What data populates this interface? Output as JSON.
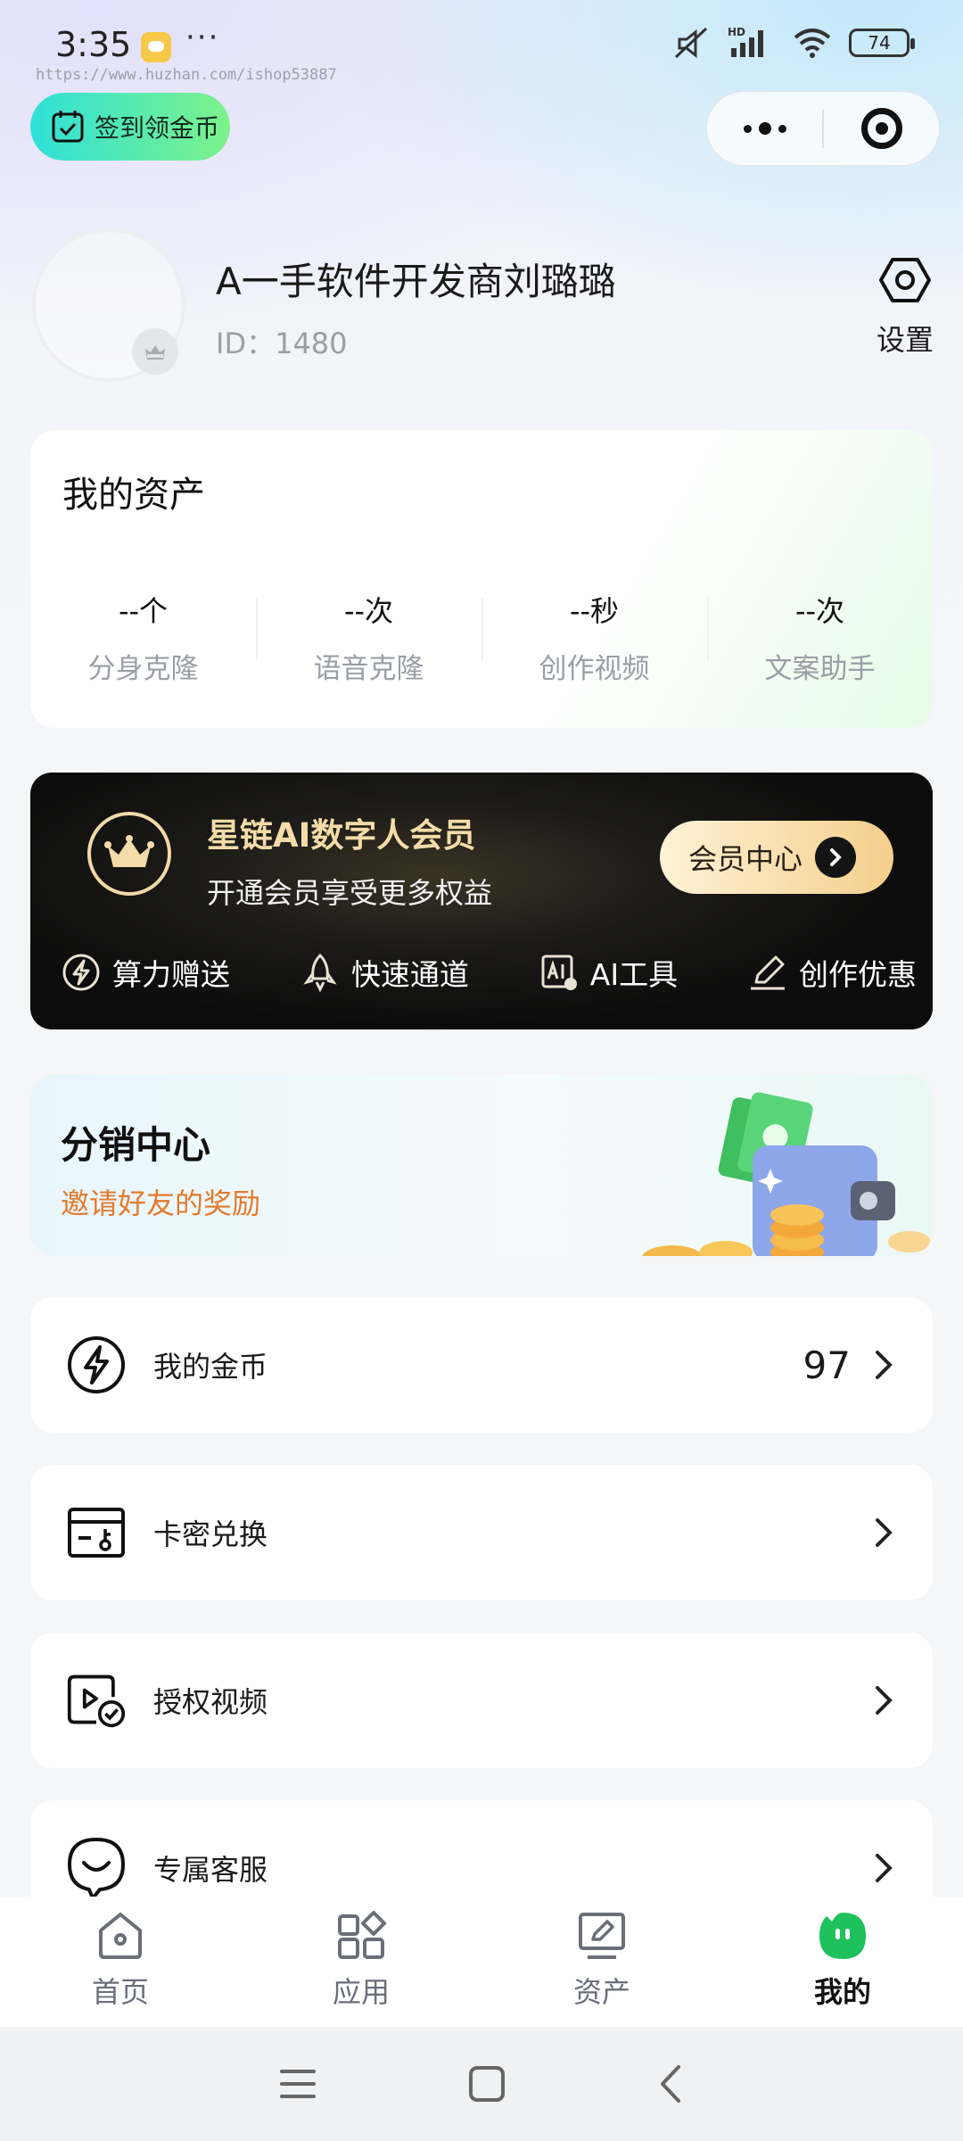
{
  "status_bar": {
    "time": "3:35",
    "more": "···",
    "battery": "74",
    "network": "HD"
  },
  "watermark": "https://www.huzhan.com/ishop53887",
  "checkin": {
    "label": "签到领金币"
  },
  "profile": {
    "name": "A一手软件开发商刘璐璐",
    "id": "ID：1480",
    "settings_label": "设置"
  },
  "assets": {
    "title": "我的资产",
    "items": [
      {
        "value": "--个",
        "label": "分身克隆"
      },
      {
        "value": "--次",
        "label": "语音克隆"
      },
      {
        "value": "--秒",
        "label": "创作视频"
      },
      {
        "value": "--次",
        "label": "文案助手"
      }
    ]
  },
  "vip": {
    "title": "星链AI数字人会员",
    "subtitle": "开通会员享受更多权益",
    "button": "会员中心",
    "perks": [
      {
        "icon": "lightning-icon",
        "label": "算力赠送"
      },
      {
        "icon": "rocket-icon",
        "label": "快速通道"
      },
      {
        "icon": "ai-tool-icon",
        "label": "AI工具"
      },
      {
        "icon": "pen-icon",
        "label": "创作优惠"
      }
    ],
    "colors": {
      "gold": "#f3dca8",
      "button_start": "#fff2d6",
      "button_end": "#f4cf8b"
    }
  },
  "distribution": {
    "title": "分销中心",
    "subtitle": "邀请好友的奖励",
    "accent": "#e47a2c"
  },
  "menu": [
    {
      "icon": "lightning-circle-icon",
      "label": "我的金币",
      "value": "97"
    },
    {
      "icon": "card-key-icon",
      "label": "卡密兑换",
      "value": ""
    },
    {
      "icon": "video-auth-icon",
      "label": "授权视频",
      "value": ""
    },
    {
      "icon": "customer-service-icon",
      "label": "专属客服",
      "value": ""
    }
  ],
  "bottom_nav": [
    {
      "icon": "home-icon",
      "label": "首页",
      "active": false
    },
    {
      "icon": "apps-icon",
      "label": "应用",
      "active": false
    },
    {
      "icon": "assets-icon",
      "label": "资产",
      "active": false
    },
    {
      "icon": "mine-icon",
      "label": "我的",
      "active": true
    }
  ],
  "colors": {
    "active_green": "#1fc15c",
    "checkin_start": "#2fe0d8",
    "checkin_end": "#7df28a"
  }
}
